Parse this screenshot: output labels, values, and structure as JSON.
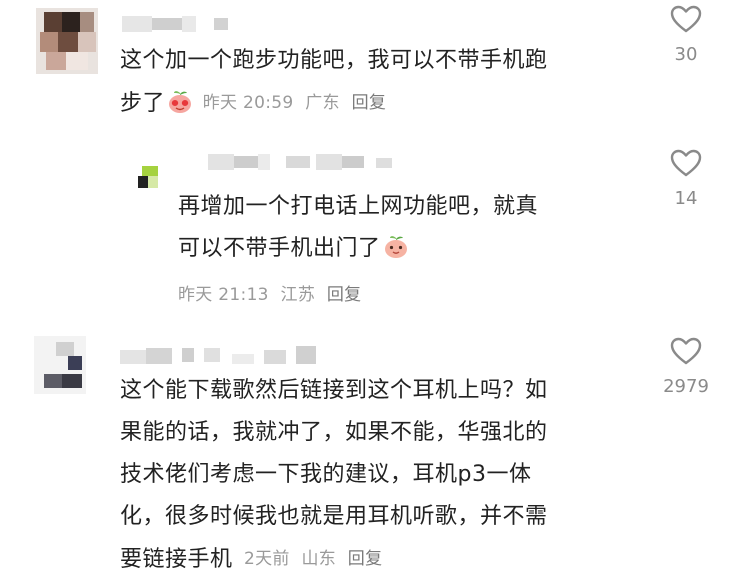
{
  "comments": [
    {
      "body_lines": [
        "这个加一个跑步功能吧，我可以不带手机跑",
        "步了"
      ],
      "time": "昨天 20:59",
      "location": "广东",
      "reply_label": "回复",
      "like_count": "30",
      "icons": {
        "like": "heart-outline-icon",
        "emoji": "peach-face-emoji"
      }
    },
    {
      "body_lines": [
        "再增加一个打电话上网功能吧，就真",
        "可以不带手机出门了"
      ],
      "time": "昨天 21:13",
      "location": "江苏",
      "reply_label": "回复",
      "like_count": "14",
      "icons": {
        "like": "heart-outline-icon",
        "emoji": "peach-face-emoji"
      }
    },
    {
      "body_lines": [
        "这个能下载歌然后链接到这个耳机上吗？如",
        "果能的话，我就冲了，如果不能，华强北的",
        "技术佬们考虑一下我的建议，耳机p3一体",
        "化，很多时候我也就是用耳机听歌，并不需",
        "要链接手机"
      ],
      "time": "2天前",
      "location": "山东",
      "reply_label": "回复",
      "like_count": "2979",
      "icons": {
        "like": "heart-outline-icon"
      }
    }
  ],
  "colors": {
    "text": "#222222",
    "meta": "#9a9a9a",
    "like": "#8a8a8a"
  }
}
